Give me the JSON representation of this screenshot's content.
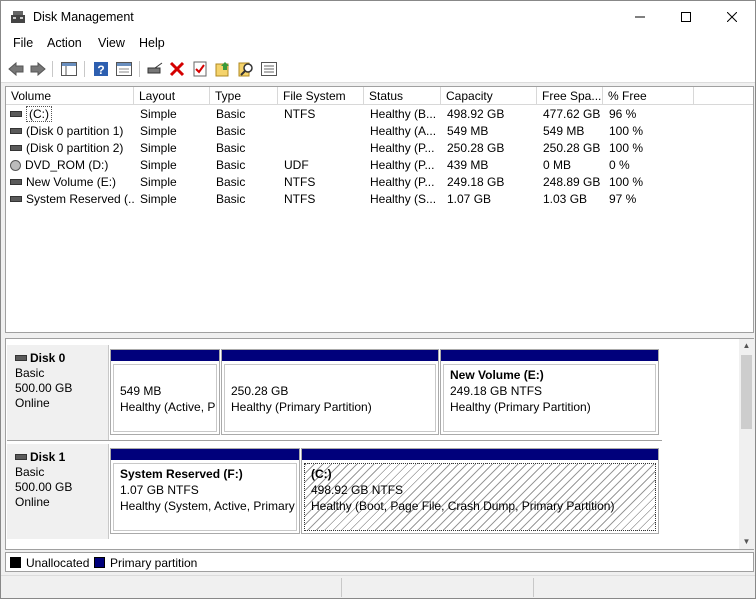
{
  "window": {
    "title": "Disk Management",
    "minimize": "—",
    "maximize": "☐",
    "close": "✕"
  },
  "menu": {
    "file": "File",
    "action": "Action",
    "view": "View",
    "help": "Help"
  },
  "columns": [
    "Volume",
    "Layout",
    "Type",
    "File System",
    "Status",
    "Capacity",
    "Free Spa...",
    "% Free"
  ],
  "volumes": [
    {
      "volume": "(C:)",
      "layout": "Simple",
      "type": "Basic",
      "fs": "NTFS",
      "status": "Healthy (B...",
      "capacity": "498.92 GB",
      "free": "477.62 GB",
      "pct": "96 %"
    },
    {
      "volume": "(Disk 0 partition 1)",
      "layout": "Simple",
      "type": "Basic",
      "fs": "",
      "status": "Healthy (A...",
      "capacity": "549 MB",
      "free": "549 MB",
      "pct": "100 %"
    },
    {
      "volume": "(Disk 0 partition 2)",
      "layout": "Simple",
      "type": "Basic",
      "fs": "",
      "status": "Healthy (P...",
      "capacity": "250.28 GB",
      "free": "250.28 GB",
      "pct": "100 %"
    },
    {
      "volume": "DVD_ROM (D:)",
      "layout": "Simple",
      "type": "Basic",
      "fs": "UDF",
      "status": "Healthy (P...",
      "capacity": "439 MB",
      "free": "0 MB",
      "pct": "0 %"
    },
    {
      "volume": "New Volume (E:)",
      "layout": "Simple",
      "type": "Basic",
      "fs": "NTFS",
      "status": "Healthy (P...",
      "capacity": "249.18 GB",
      "free": "248.89 GB",
      "pct": "100 %"
    },
    {
      "volume": "System Reserved (...",
      "layout": "Simple",
      "type": "Basic",
      "fs": "NTFS",
      "status": "Healthy (S...",
      "capacity": "1.07 GB",
      "free": "1.03 GB",
      "pct": "97 %"
    }
  ],
  "disks": [
    {
      "name": "Disk 0",
      "type": "Basic",
      "size": "500.00 GB",
      "state": "Online",
      "partitions": [
        {
          "name": "",
          "size": "549 MB",
          "status": "Healthy (Active, P"
        },
        {
          "name": "",
          "size": "250.28 GB",
          "status": "Healthy (Primary Partition)"
        },
        {
          "name": "New Volume  (E:)",
          "size": "249.18 GB NTFS",
          "status": "Healthy (Primary Partition)"
        }
      ]
    },
    {
      "name": "Disk 1",
      "type": "Basic",
      "size": "500.00 GB",
      "state": "Online",
      "partitions": [
        {
          "name": "System Reserved  (F:)",
          "size": "1.07 GB NTFS",
          "status": "Healthy (System, Active, Primary"
        },
        {
          "name": "(C:)",
          "size": "498.92 GB NTFS",
          "status": "Healthy (Boot, Page File, Crash Dump, Primary Partition)"
        }
      ]
    }
  ],
  "legend": {
    "unallocated": "Unallocated",
    "primary": "Primary partition"
  },
  "colors": {
    "primary_partition": "#00007b",
    "unallocated": "#000000"
  },
  "toolbar_icons": [
    "back-arrow-icon",
    "forward-arrow-icon",
    "console-tree-icon",
    "help-icon",
    "properties-icon",
    "connect-icon",
    "delete-icon",
    "checklist-icon",
    "import-icon",
    "search-icon",
    "list-icon"
  ]
}
